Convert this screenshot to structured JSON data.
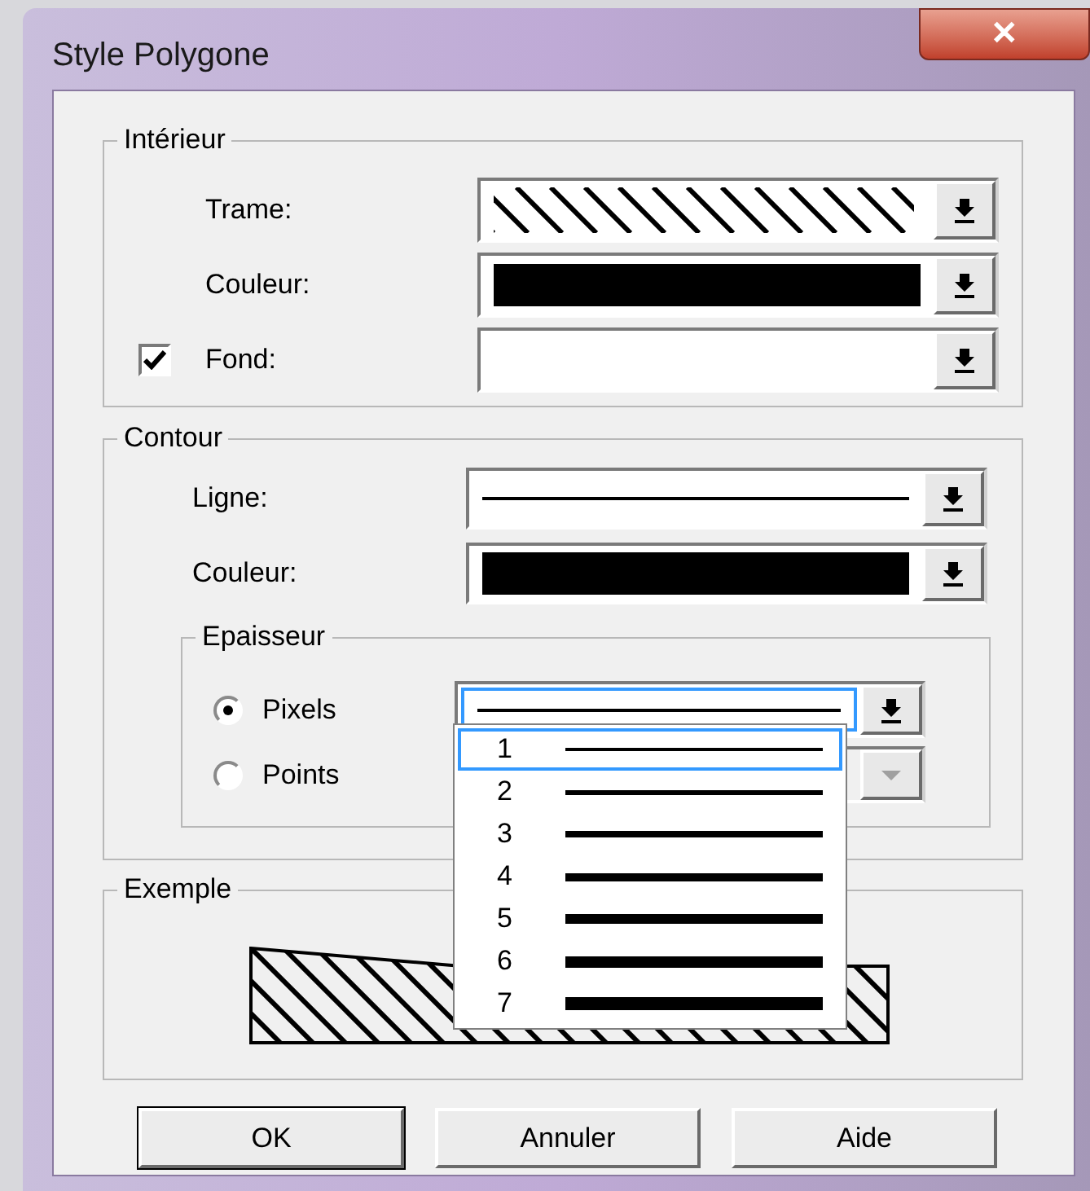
{
  "window": {
    "title": "Style Polygone",
    "close": "✕"
  },
  "interieur": {
    "legend": "Intérieur",
    "rows": [
      {
        "label": "Trame:",
        "kind": "hatch"
      },
      {
        "label": "Couleur:",
        "kind": "color",
        "color": "#000000"
      },
      {
        "label": "Fond:",
        "kind": "empty",
        "checkbox": true,
        "checked": true
      }
    ]
  },
  "contour": {
    "legend": "Contour",
    "rows": [
      {
        "label": "Ligne:",
        "kind": "line"
      },
      {
        "label": "Couleur:",
        "kind": "color",
        "color": "#000000"
      }
    ],
    "epaisseur": {
      "legend": "Epaisseur",
      "options": [
        {
          "label": "Pixels",
          "selected": true,
          "disabled": false
        },
        {
          "label": "Points",
          "selected": false,
          "disabled": true
        }
      ]
    }
  },
  "thickness_list": {
    "items": [
      {
        "label": "1",
        "selected": true
      },
      {
        "label": "2",
        "selected": false
      },
      {
        "label": "3",
        "selected": false
      },
      {
        "label": "4",
        "selected": false
      },
      {
        "label": "5",
        "selected": false
      },
      {
        "label": "6",
        "selected": false
      },
      {
        "label": "7",
        "selected": false
      }
    ]
  },
  "exemple": {
    "legend": "Exemple"
  },
  "buttons": [
    "OK",
    "Annuler",
    "Aide"
  ]
}
